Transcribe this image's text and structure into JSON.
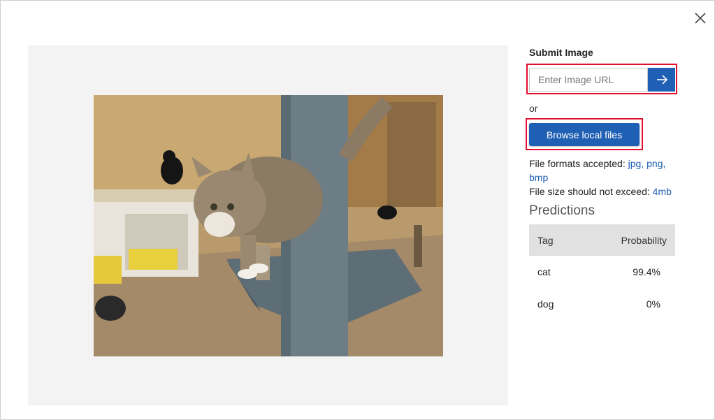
{
  "dialog": {
    "close_icon": "close-icon"
  },
  "preview": {
    "image_alt": "cat on scratching post"
  },
  "submit": {
    "title": "Submit Image",
    "url_placeholder": "Enter Image URL",
    "url_value": "",
    "go_icon": "arrow-right-icon",
    "or_label": "or",
    "browse_label": "Browse local files",
    "highlight_color": "#e0102e",
    "accent_color": "#2060b4"
  },
  "requirements": {
    "formats_prefix": "File formats accepted: ",
    "formats_value": "jpg, png, bmp",
    "size_prefix": "File size should not exceed: ",
    "size_value": "4mb"
  },
  "predictions": {
    "title": "Predictions",
    "columns": [
      "Tag",
      "Probability"
    ],
    "rows": [
      {
        "tag": "cat",
        "probability": "99.4%"
      },
      {
        "tag": "dog",
        "probability": "0%"
      }
    ]
  }
}
